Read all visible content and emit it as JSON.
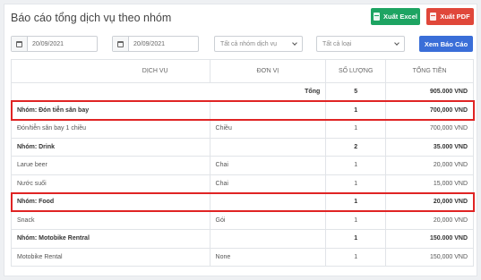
{
  "header": {
    "title": "Báo cáo tổng dịch vụ theo nhóm",
    "export_excel": "Xuất Excel",
    "export_pdf": "Xuất PDF"
  },
  "filters": {
    "date_from": "20/09/2021",
    "date_to": "20/09/2021",
    "group_select": "Tất cả nhóm dịch vụ",
    "type_select": "Tất cả loại",
    "view_button": "Xem Báo Cáo"
  },
  "table": {
    "headers": {
      "service": "Dịch vụ",
      "unit": "Đơn vị",
      "quantity": "Số lượng",
      "total": "Tổng tiền"
    },
    "summary": {
      "label": "Tổng",
      "quantity": "5",
      "total": "905.000 VND"
    },
    "rows": [
      {
        "kind": "group",
        "label": "Nhóm: Đón tiễn sân bay",
        "unit": "",
        "quantity": "1",
        "total": "700,000 VND",
        "highlighted": true
      },
      {
        "kind": "item",
        "label": "Đón/tiễn sân bay 1 chiều",
        "unit": "Chiều",
        "quantity": "1",
        "total": "700,000 VND"
      },
      {
        "kind": "group",
        "label": "Nhóm: Drink",
        "unit": "",
        "quantity": "2",
        "total": "35.000 VND"
      },
      {
        "kind": "item",
        "label": "Larue beer",
        "unit": "Chai",
        "quantity": "1",
        "total": "20,000 VND"
      },
      {
        "kind": "item",
        "label": "Nước suối",
        "unit": "Chai",
        "quantity": "1",
        "total": "15,000 VND"
      },
      {
        "kind": "group",
        "label": "Nhóm: Food",
        "unit": "",
        "quantity": "1",
        "total": "20,000 VND",
        "highlighted": true
      },
      {
        "kind": "item",
        "label": "Snack",
        "unit": "Gói",
        "quantity": "1",
        "total": "20,000 VND"
      },
      {
        "kind": "group",
        "label": "Nhóm: Motobike Rentral",
        "unit": "",
        "quantity": "1",
        "total": "150.000 VND"
      },
      {
        "kind": "item",
        "label": "Motobike Rental",
        "unit": "None",
        "quantity": "1",
        "total": "150,000 VND"
      }
    ]
  },
  "colors": {
    "excel": "#1da462",
    "pdf": "#e0473a",
    "primary": "#3a6ed8",
    "highlight": "#e02424"
  }
}
